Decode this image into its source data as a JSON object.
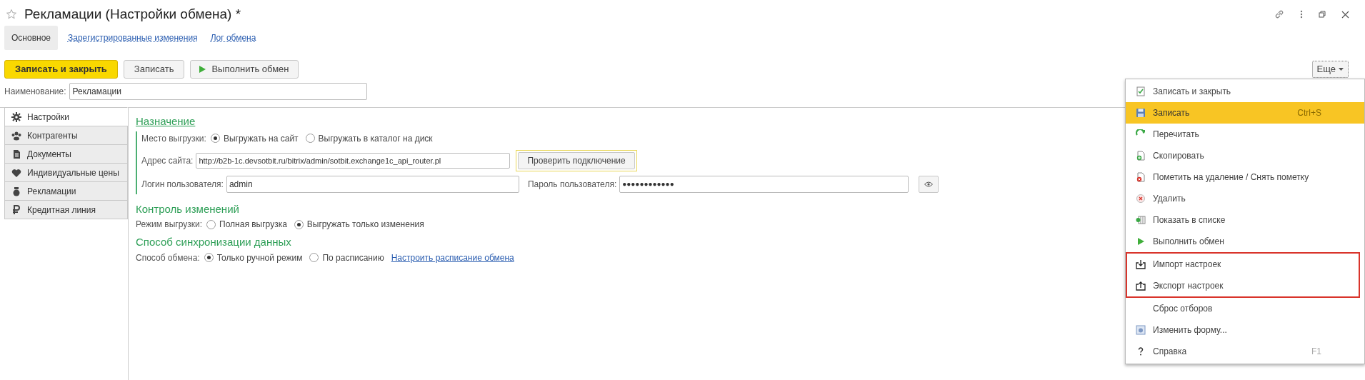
{
  "window": {
    "title": "Рекламации (Настройки обмена) *"
  },
  "nav": [
    {
      "label": "Основное",
      "selected": true
    },
    {
      "label": "Зарегистрированные изменения",
      "selected": false
    },
    {
      "label": "Лог обмена",
      "selected": false
    }
  ],
  "toolbar": {
    "save_close": "Записать и закрыть",
    "save": "Записать",
    "run": "Выполнить обмен",
    "more": "Еще"
  },
  "name_field": {
    "label": "Наименование:",
    "value": "Рекламации"
  },
  "side_tabs": [
    {
      "label": "Настройки",
      "selected": true
    },
    {
      "label": "Контрагенты",
      "selected": false
    },
    {
      "label": "Документы",
      "selected": false
    },
    {
      "label": "Индивидуальные цены",
      "selected": false
    },
    {
      "label": "Рекламации",
      "selected": false
    },
    {
      "label": "Кредитная линия",
      "selected": false
    }
  ],
  "purpose": {
    "title": "Назначение",
    "place_label": "Место выгрузки:",
    "place_options": [
      {
        "label": "Выгружать на сайт",
        "selected": true
      },
      {
        "label": "Выгружать в каталог на диск",
        "selected": false
      }
    ],
    "address_label": "Адрес сайта:",
    "address": "http://b2b-1c.devsotbit.ru/bitrix/admin/sotbit.exchange1c_api_router.pl",
    "check_button": "Проверить подключение",
    "login_label": "Логин пользователя:",
    "login": "admin",
    "password_label": "Пароль пользователя:",
    "password": "●●●●●●●●●●●●"
  },
  "changes": {
    "title": "Контроль изменений",
    "mode_label": "Режим выгрузки:",
    "mode_options": [
      {
        "label": "Полная выгрузка",
        "selected": false
      },
      {
        "label": "Выгружать только изменения",
        "selected": true
      }
    ]
  },
  "sync": {
    "title": "Способ синхронизации данных",
    "method_label": "Способ обмена:",
    "method_options": [
      {
        "label": "Только ручной режим",
        "selected": true
      },
      {
        "label": "По расписанию",
        "selected": false
      }
    ],
    "schedule_link": "Настроить расписание обмена"
  },
  "menu": [
    {
      "label": "Записать и закрыть",
      "selected": false,
      "outlined": false
    },
    {
      "label": "Записать",
      "shortcut": "Ctrl+S",
      "selected": true,
      "outlined": false
    },
    {
      "label": "Перечитать",
      "selected": false,
      "outlined": false
    },
    {
      "label": "Скопировать",
      "selected": false,
      "outlined": false
    },
    {
      "label": "Пометить на удаление / Снять пометку",
      "selected": false,
      "outlined": false
    },
    {
      "label": "Удалить",
      "selected": false,
      "outlined": false
    },
    {
      "label": "Показать в списке",
      "selected": false,
      "outlined": false
    },
    {
      "label": "Выполнить обмен",
      "selected": false,
      "outlined": false
    },
    {
      "label": "Импорт настроек",
      "selected": false,
      "outlined": true
    },
    {
      "label": "Экспорт настроек",
      "selected": false,
      "outlined": true
    },
    {
      "label": "Сброс отборов",
      "selected": false,
      "outlined": false
    },
    {
      "label": "Изменить форму...",
      "selected": false,
      "outlined": false
    },
    {
      "label": "Справка",
      "shortcut": "F1",
      "selected": false,
      "outlined": false
    }
  ]
}
